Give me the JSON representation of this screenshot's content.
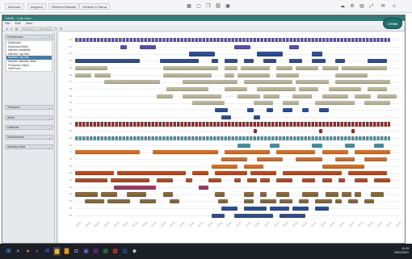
{
  "top_bar": {
    "menus": [
      "Akronsel",
      "Angvers",
      "Retrieve Baskets",
      "Orelane & Sarna"
    ],
    "toolbar_icons": [
      "grid-icon",
      "square-icon",
      "copy-icon",
      "link-icon",
      "window-icon",
      "cloud-icon",
      "gear-icon",
      "box-icon",
      "expand-icon",
      "mail-icon",
      "user-icon"
    ]
  },
  "app": {
    "title": "CAME - Lost Lane",
    "menu": [
      "File",
      "Edit",
      "View"
    ],
    "date_from": "06/01/2021",
    "date_to": "06/01/2021",
    "user_badge": "CYON"
  },
  "left_panel": {
    "sections": [
      {
        "label": "Preferences",
        "expanded": true
      },
      {
        "label": "Transport",
        "expanded": false
      },
      {
        "label": "Alerts",
        "expanded": false
      },
      {
        "label": "Calendar",
        "expanded": false
      },
      {
        "label": "Maintenance",
        "expanded": false
      },
      {
        "label": "Auxiliary Data",
        "expanded": false
      }
    ],
    "nav_items": [
      "Dashboard",
      "Dashboard Detail",
      "Machine availability",
      "Machine Log Data",
      "Machine Log Data",
      "Machine utilization detail",
      "Production Output",
      "Shift Event"
    ],
    "active_index": 4
  },
  "chart_data": {
    "type": "gantt",
    "rows": [
      "01",
      "02",
      "03",
      "04",
      "05",
      "06",
      "07",
      "08",
      "09",
      "10",
      "11",
      "12",
      "13",
      "14",
      "15",
      "16",
      "17",
      "18",
      "19",
      "20",
      "21",
      "22",
      "23",
      "24",
      "25",
      "26"
    ],
    "x_ticks": [
      "08:00",
      "08:15",
      "08:30",
      "08:45",
      "09:00",
      "09:15",
      "09:30",
      "09:45",
      "10:00",
      "10:15",
      "10:30",
      "10:45",
      "11:00",
      "11:15",
      "11:30",
      "11:45",
      "12:00",
      "12:15",
      "12:30",
      "12:45",
      "13:00",
      "13:15",
      "13:30",
      "13:45",
      "14:00",
      "14:15",
      "14:30",
      "14:45",
      "15:00",
      "15:15",
      "15:30",
      "15:45",
      "16:00",
      "16:15",
      "16:30"
    ],
    "colors": {
      "purple": "#5a4fa8",
      "navy": "#2e4f95",
      "khaki": "#bdb79a",
      "khaki_dark": "#8e8a6c",
      "teal": "#4a8fa0",
      "maroon": "#8e2e2a",
      "orange": "#d4702e",
      "rust": "#b84a24",
      "magenta": "#9c3c5e",
      "brown": "#8a6a3c"
    },
    "row_colors": [
      "purple",
      "purple",
      "navy",
      "navy",
      "khaki",
      "khaki",
      "khaki",
      "khaki",
      "khaki",
      "khaki",
      "navy",
      "navy",
      "maroon",
      "maroon",
      "teal",
      "teal",
      "orange",
      "orange",
      "orange",
      "rust",
      "rust",
      "magenta",
      "brown",
      "brown",
      "navy",
      "navy"
    ],
    "bars": [
      [
        [
          0,
          0.97
        ]
      ],
      [
        [
          0.14,
          0.02
        ],
        [
          0.2,
          0.05
        ],
        [
          0.49,
          0.05
        ],
        [
          0.66,
          0.03
        ]
      ],
      [
        [
          0.35,
          0.08
        ],
        [
          0.56,
          0.05
        ],
        [
          0.6,
          0.04
        ],
        [
          0.73,
          0.03
        ]
      ],
      [
        [
          0.0,
          0.2
        ],
        [
          0.26,
          0.12
        ],
        [
          0.42,
          0.02
        ],
        [
          0.46,
          0.04
        ],
        [
          0.52,
          0.03
        ],
        [
          0.58,
          0.04
        ],
        [
          0.66,
          0.04
        ],
        [
          0.73,
          0.04
        ],
        [
          0.8,
          0.03
        ],
        [
          0.9,
          0.06
        ]
      ],
      [
        [
          0.0,
          0.1
        ],
        [
          0.27,
          0.17
        ],
        [
          0.46,
          0.04
        ],
        [
          0.51,
          0.09
        ],
        [
          0.62,
          0.05
        ],
        [
          0.68,
          0.07
        ],
        [
          0.76,
          0.05
        ],
        [
          0.82,
          0.14
        ]
      ],
      [
        [
          0.0,
          0.05
        ],
        [
          0.06,
          0.05
        ],
        [
          0.27,
          0.15
        ],
        [
          0.46,
          0.03
        ],
        [
          0.5,
          0.1
        ],
        [
          0.62,
          0.07
        ],
        [
          0.8,
          0.1
        ]
      ],
      [
        [
          0.09,
          0.17
        ],
        [
          0.33,
          0.17
        ],
        [
          0.52,
          0.15
        ],
        [
          0.68,
          0.1
        ],
        [
          0.8,
          0.17
        ]
      ],
      [
        [
          0.28,
          0.13
        ],
        [
          0.46,
          0.07
        ],
        [
          0.56,
          0.12
        ],
        [
          0.69,
          0.06
        ],
        [
          0.78,
          0.1
        ],
        [
          0.9,
          0.06
        ]
      ],
      [
        [
          0.25,
          0.05
        ],
        [
          0.33,
          0.12
        ],
        [
          0.5,
          0.07
        ],
        [
          0.58,
          0.05
        ],
        [
          0.67,
          0.06
        ],
        [
          0.76,
          0.08
        ],
        [
          0.86,
          0.05
        ],
        [
          0.93,
          0.06
        ]
      ],
      [
        [
          0.36,
          0.1
        ],
        [
          0.55,
          0.06
        ],
        [
          0.64,
          0.05
        ],
        [
          0.74,
          0.12
        ],
        [
          0.89,
          0.08
        ]
      ],
      [
        [
          0.43,
          0.04
        ],
        [
          0.53,
          0.02
        ],
        [
          0.59,
          0.02
        ],
        [
          0.64,
          0.03
        ],
        [
          0.7,
          0.02
        ],
        [
          0.75,
          0.03
        ]
      ],
      [
        [
          0.45,
          0.03
        ],
        [
          0.55,
          0.02
        ]
      ],
      [
        [
          0.0,
          0.97
        ]
      ],
      [
        [
          0.55,
          0.01
        ],
        [
          0.75,
          0.01
        ],
        [
          0.85,
          0.01
        ]
      ],
      [
        [
          0.0,
          0.97
        ]
      ],
      [
        [
          0.5,
          0.04
        ],
        [
          0.6,
          0.03
        ],
        [
          0.73,
          0.03
        ],
        [
          0.83,
          0.03
        ],
        [
          0.92,
          0.03
        ]
      ],
      [
        [
          0.0,
          0.2
        ],
        [
          0.24,
          0.2
        ],
        [
          0.46,
          0.14
        ],
        [
          0.62,
          0.12
        ],
        [
          0.76,
          0.08
        ],
        [
          0.86,
          0.08
        ],
        [
          0.93,
          0.04
        ]
      ],
      [
        [
          0.45,
          0.08
        ],
        [
          0.56,
          0.08
        ],
        [
          0.68,
          0.08
        ],
        [
          0.8,
          0.06
        ],
        [
          0.89,
          0.07
        ]
      ],
      [
        [
          0.42,
          0.08
        ],
        [
          0.52,
          0.06
        ],
        [
          0.76,
          0.13
        ]
      ],
      [
        [
          0.0,
          0.12
        ],
        [
          0.13,
          0.21
        ],
        [
          0.36,
          0.05
        ],
        [
          0.43,
          0.1
        ],
        [
          0.54,
          0.08
        ],
        [
          0.64,
          0.18
        ],
        [
          0.84,
          0.12
        ]
      ],
      [
        [
          0.0,
          0.1
        ],
        [
          0.11,
          0.12
        ],
        [
          0.25,
          0.05
        ],
        [
          0.34,
          0.02
        ],
        [
          0.41,
          0.04
        ],
        [
          0.49,
          0.02
        ],
        [
          0.53,
          0.03
        ],
        [
          0.57,
          0.03
        ],
        [
          0.62,
          0.05
        ],
        [
          0.7,
          0.04
        ],
        [
          0.76,
          0.03
        ],
        [
          0.81,
          0.02
        ],
        [
          0.86,
          0.04
        ],
        [
          0.92,
          0.05
        ]
      ],
      [
        [
          0.12,
          0.13
        ],
        [
          0.38,
          0.03
        ]
      ],
      [
        [
          0.0,
          0.07
        ],
        [
          0.08,
          0.05
        ],
        [
          0.16,
          0.06
        ],
        [
          0.27,
          0.03
        ],
        [
          0.43,
          0.03
        ],
        [
          0.52,
          0.03
        ],
        [
          0.57,
          0.02
        ],
        [
          0.62,
          0.04
        ],
        [
          0.7,
          0.05
        ],
        [
          0.77,
          0.04
        ],
        [
          0.82,
          0.03
        ],
        [
          0.86,
          0.02
        ],
        [
          0.91,
          0.04
        ]
      ],
      [
        [
          0.03,
          0.06
        ],
        [
          0.1,
          0.07
        ],
        [
          0.2,
          0.05
        ],
        [
          0.29,
          0.03
        ],
        [
          0.44,
          0.03
        ],
        [
          0.52,
          0.03
        ],
        [
          0.57,
          0.05
        ],
        [
          0.63,
          0.04
        ],
        [
          0.69,
          0.03
        ],
        [
          0.74,
          0.05
        ],
        [
          0.8,
          0.02
        ],
        [
          0.84,
          0.03
        ],
        [
          0.89,
          0.03
        ]
      ],
      [
        [
          0.45,
          0.05
        ],
        [
          0.52,
          0.07
        ],
        [
          0.6,
          0.06
        ],
        [
          0.67,
          0.05
        ],
        [
          0.74,
          0.04
        ]
      ],
      [
        [
          0.42,
          0.04
        ],
        [
          0.49,
          0.12
        ],
        [
          0.63,
          0.08
        ]
      ]
    ]
  },
  "taskbar": {
    "apps": [
      "windows-icon",
      "search-icon",
      "firefox-icon",
      "edge-icon",
      "mail-icon",
      "file-explorer-icon",
      "folder-icon",
      "store-icon",
      "teams-icon",
      "onenote-icon",
      "excel-icon",
      "powerpoint-icon",
      "word-icon",
      "app-icon"
    ],
    "time": "10:15",
    "date": "06/01/2021"
  }
}
